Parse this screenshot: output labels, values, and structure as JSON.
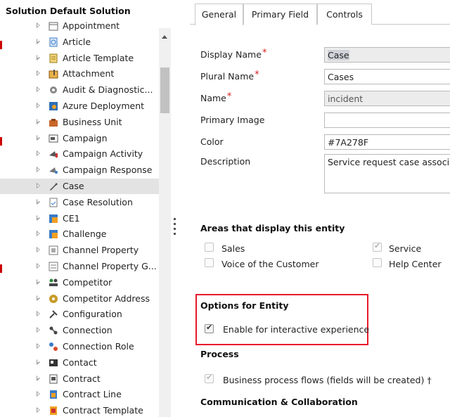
{
  "left_panel": {
    "title": "Solution Default Solution",
    "items": [
      {
        "label": "Appointment",
        "icon": "appointment-icon"
      },
      {
        "label": "Article",
        "icon": "article-icon"
      },
      {
        "label": "Article Template",
        "icon": "article-template-icon"
      },
      {
        "label": "Attachment",
        "icon": "attachment-icon"
      },
      {
        "label": "Audit & Diagnostic...",
        "icon": "audit-icon"
      },
      {
        "label": "Azure Deployment",
        "icon": "azure-deployment-icon"
      },
      {
        "label": "Business Unit",
        "icon": "business-unit-icon"
      },
      {
        "label": "Campaign",
        "icon": "campaign-icon"
      },
      {
        "label": "Campaign Activity",
        "icon": "campaign-activity-icon"
      },
      {
        "label": "Campaign Response",
        "icon": "campaign-response-icon"
      },
      {
        "label": "Case",
        "icon": "wrench-icon",
        "selected": true
      },
      {
        "label": "Case Resolution",
        "icon": "case-resolution-icon"
      },
      {
        "label": "CE1",
        "icon": "entity-icon"
      },
      {
        "label": "Challenge",
        "icon": "entity-icon"
      },
      {
        "label": "Channel Property",
        "icon": "channel-property-icon"
      },
      {
        "label": "Channel Property G...",
        "icon": "channel-property-group-icon"
      },
      {
        "label": "Competitor",
        "icon": "competitor-icon"
      },
      {
        "label": "Competitor Address",
        "icon": "competitor-address-icon"
      },
      {
        "label": "Configuration",
        "icon": "configuration-icon"
      },
      {
        "label": "Connection",
        "icon": "connection-icon"
      },
      {
        "label": "Connection Role",
        "icon": "connection-role-icon"
      },
      {
        "label": "Contact",
        "icon": "contact-icon"
      },
      {
        "label": "Contract",
        "icon": "contract-icon"
      },
      {
        "label": "Contract Line",
        "icon": "contract-line-icon"
      },
      {
        "label": "Contract Template",
        "icon": "contract-template-icon"
      }
    ]
  },
  "tabs": [
    {
      "label": "General",
      "active": true
    },
    {
      "label": "Primary Field",
      "active": false
    },
    {
      "label": "Controls",
      "active": false
    }
  ],
  "form": {
    "display_name": {
      "label": "Display Name",
      "value": "Case",
      "required": true
    },
    "plural_name": {
      "label": "Plural Name",
      "value": "Cases",
      "required": true
    },
    "name": {
      "label": "Name",
      "value": "incident",
      "required": true
    },
    "primary_image": {
      "label": "Primary Image",
      "value": ""
    },
    "color": {
      "label": "Color",
      "value": "#7A278F"
    },
    "description": {
      "label": "Description",
      "value": "Service request case associat"
    }
  },
  "areas": {
    "title": "Areas that display this entity",
    "items": [
      {
        "label": "Sales",
        "checked": false
      },
      {
        "label": "Service",
        "checked": true
      },
      {
        "label": "Voice of the Customer",
        "checked": false
      },
      {
        "label": "Help Center",
        "checked": false
      }
    ]
  },
  "options": {
    "title": "Options for Entity",
    "interactive_label": "Enable for interactive experience",
    "interactive_checked": true
  },
  "process": {
    "title": "Process",
    "bpf_label": "Business process flows (fields will be created) †",
    "bpf_checked": true
  },
  "communication": {
    "title": "Communication & Collaboration"
  },
  "colors": {
    "required": "#d21f1f",
    "highlight_border": "#e8192c",
    "selected_row": "#e3e3e3"
  }
}
